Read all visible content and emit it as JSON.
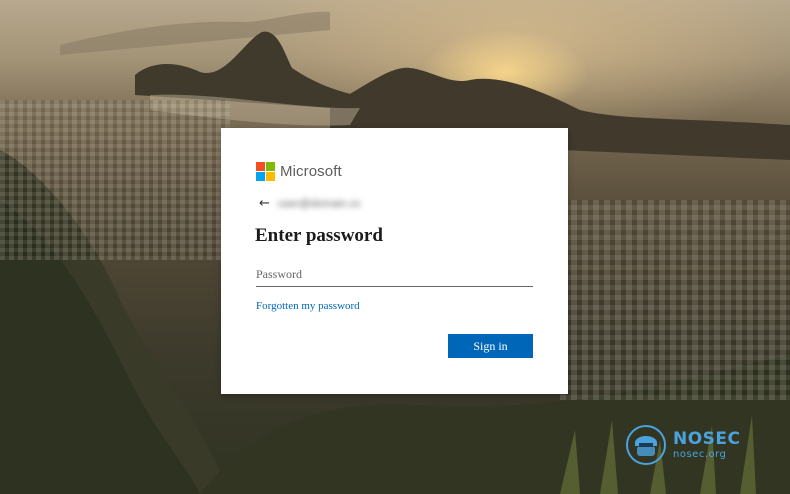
{
  "brand": {
    "name": "Microsoft"
  },
  "account": {
    "identifier": "user@domain.xx"
  },
  "form": {
    "heading": "Enter password",
    "password_placeholder": "Password",
    "forgot_link": "Forgotten my password",
    "signin_label": "Sign in"
  },
  "watermark": {
    "title": "NOSEC",
    "subtitle": "nosec.org"
  },
  "icons": {
    "back": "arrow-left-icon",
    "logo": "microsoft-logo-icon",
    "watermark": "nosec-shield-icon"
  },
  "colors": {
    "accent": "#0067b8",
    "logo_red": "#f25022",
    "logo_green": "#7fba00",
    "logo_blue": "#00a4ef",
    "logo_yellow": "#ffb900",
    "watermark": "#4aa3df"
  }
}
